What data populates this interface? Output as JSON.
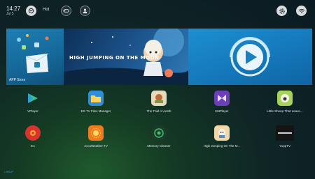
{
  "header": {
    "time": "14:27",
    "date": "Jul 5",
    "hot_label": "Hot"
  },
  "banners": {
    "store_label": "APP Store",
    "moon_title": "HIGH JUMPING ON THE MOON"
  },
  "apps_row1": [
    {
      "label": "VPlayer"
    },
    {
      "label": "ES TV Files Manager"
    },
    {
      "label": "The Trial of Aesth"
    },
    {
      "label": "KMPlayer"
    },
    {
      "label": "Little Sheep That Leave..."
    }
  ],
  "apps_row2": [
    {
      "label": "EA"
    },
    {
      "label": "AccuWeather TV"
    },
    {
      "label": "Memory Cleaner"
    },
    {
      "label": "High Jumping On The M..."
    },
    {
      "label": "YuppTV"
    }
  ],
  "footer": {
    "help": "• HELP"
  },
  "colors": {
    "accent": "#1f7fb3",
    "help": "#3ea0e6"
  }
}
